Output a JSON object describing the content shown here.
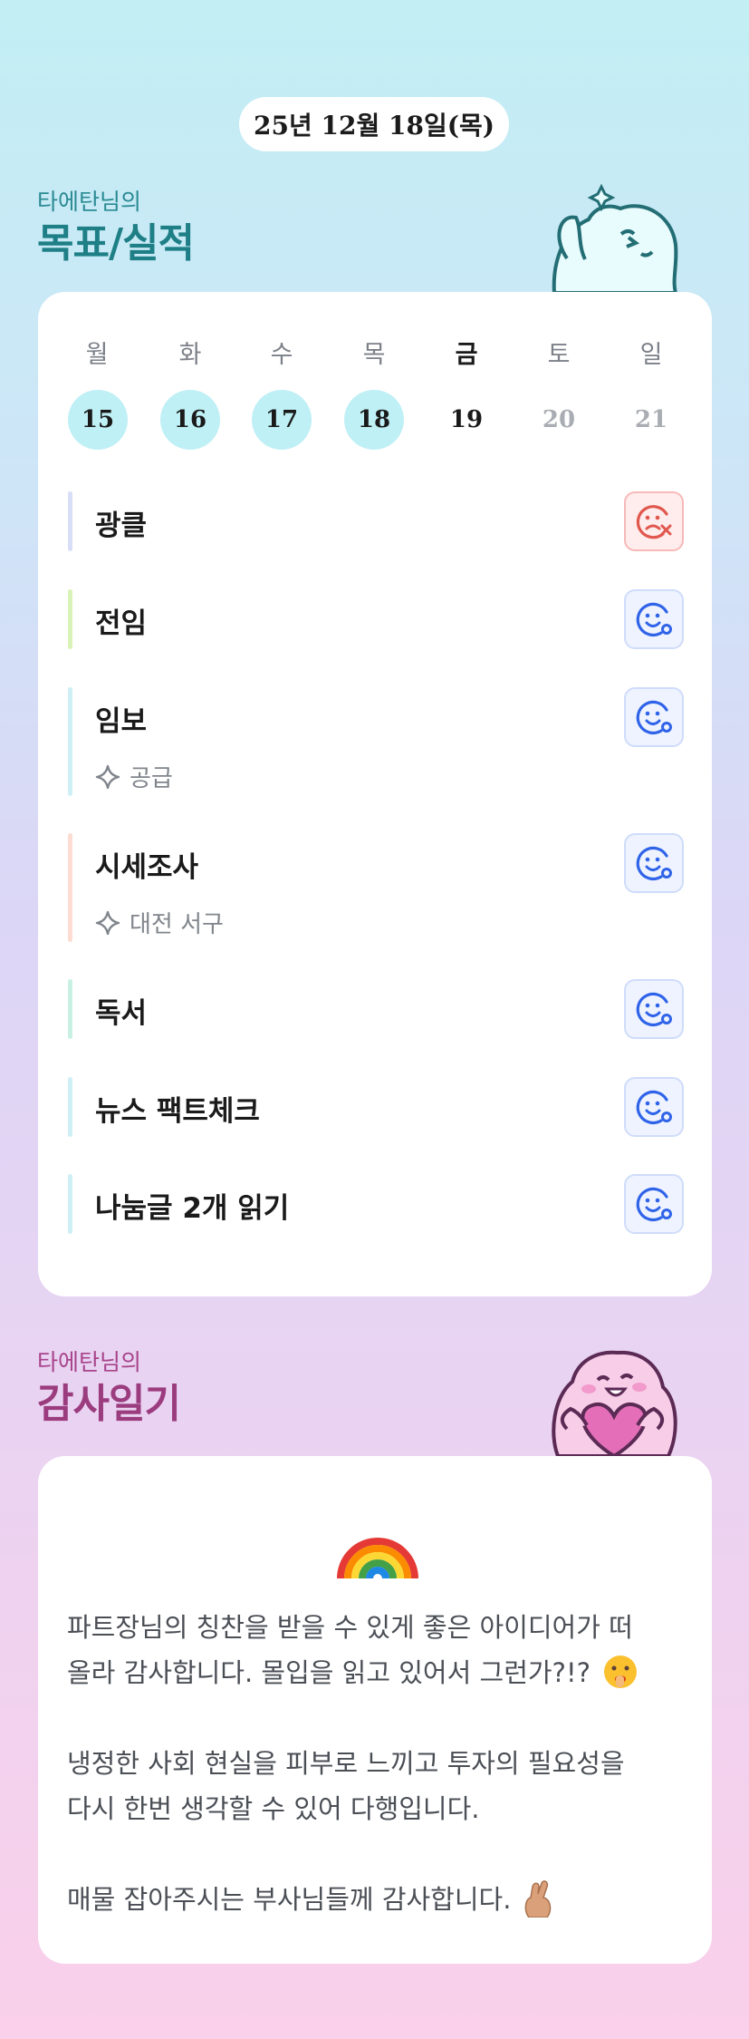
{
  "date": "25년 12월 18일(목)",
  "goals_section": {
    "owner": "타에탄님의",
    "title": "목표/실적"
  },
  "week": {
    "days": [
      {
        "name": "월",
        "num": "15",
        "state": "hit"
      },
      {
        "name": "화",
        "num": "16",
        "state": "hit"
      },
      {
        "name": "수",
        "num": "17",
        "state": "hit"
      },
      {
        "name": "목",
        "num": "18",
        "state": "hit"
      },
      {
        "name": "금",
        "num": "19",
        "state": "today"
      },
      {
        "name": "토",
        "num": "20",
        "state": "future"
      },
      {
        "name": "일",
        "num": "21",
        "state": "future"
      }
    ]
  },
  "goals": [
    {
      "title": "광클",
      "sub": "",
      "bar_color": "#d9def7",
      "status": "fail"
    },
    {
      "title": "전임",
      "sub": "",
      "bar_color": "#d9f2b8",
      "status": "ok"
    },
    {
      "title": "임보",
      "sub": "공급",
      "bar_color": "#cdeff5",
      "status": "ok"
    },
    {
      "title": "시세조사",
      "sub": "대전 서구",
      "bar_color": "#fcdcd3",
      "status": "ok"
    },
    {
      "title": "독서",
      "sub": "",
      "bar_color": "#c8f1e3",
      "status": "ok"
    },
    {
      "title": "뉴스 팩트체크",
      "sub": "",
      "bar_color": "#cfeff6",
      "status": "ok"
    },
    {
      "title": "나눔글 2개 읽기",
      "sub": "",
      "bar_color": "#cfeff6",
      "status": "ok"
    }
  ],
  "journal_section": {
    "owner": "타에탄님의",
    "title": "감사일기"
  },
  "journal": {
    "icon": "rainbow-icon",
    "lines": [
      "파트장님의 칭찬을 받을 수 있게 좋은 아이디어가 떠",
      "올라 감사합니다. 몰입을 읽고 있어서 그런가?!?",
      "냉정한 사회 현실을 피부로 느끼고 투자의 필요성을",
      "다시 한번 생각할 수 있어 다행입니다.",
      "매물 잡아주시는 부사님들께 감사합니다."
    ]
  },
  "colors": {
    "goals_accent": "#1f7f86",
    "journal_accent": "#9b3c7f",
    "ok_icon": "#2f63e8",
    "fail_icon": "#e0574e",
    "hit_circle": "#bff0f5"
  }
}
